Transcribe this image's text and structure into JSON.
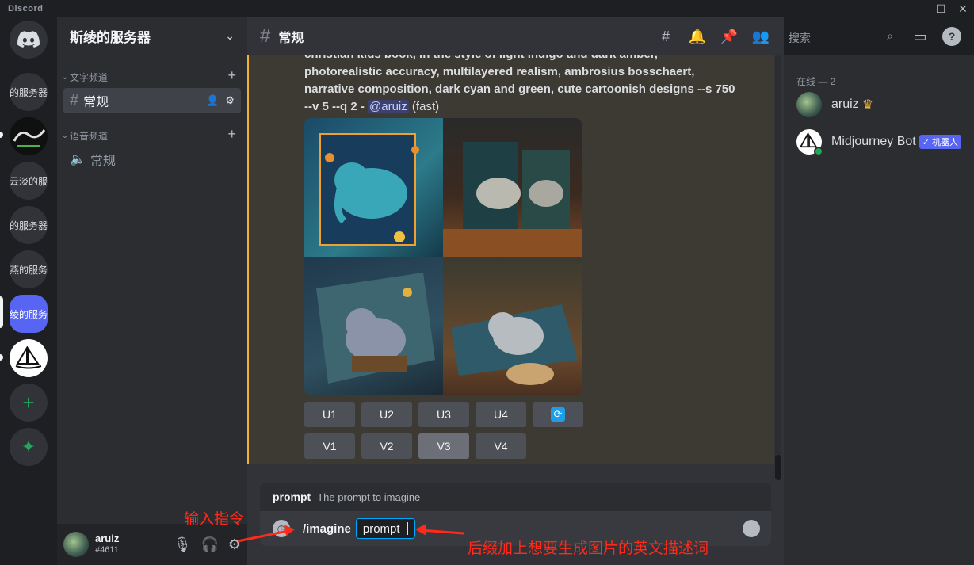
{
  "app": {
    "brand": "Discord"
  },
  "window_controls": {
    "minimize": "—",
    "maximize": "☐",
    "close": "✕"
  },
  "servers": [
    {
      "name": "的服务器"
    },
    {
      "name": ""
    },
    {
      "name": "云淡的服务"
    },
    {
      "name": "的服务器"
    },
    {
      "name": "燕的服务"
    },
    {
      "name": "绫的服务"
    }
  ],
  "guild": {
    "name": "斯绫的服务器"
  },
  "categories": {
    "text": "文字频道",
    "voice": "语音频道"
  },
  "channels": {
    "text_general": "常规",
    "voice_general": "常规"
  },
  "user": {
    "name": "aruiz",
    "tag": "#4611"
  },
  "chat": {
    "channel_name": "常规",
    "message_line1": "christian kids book, in the style of light indigo and dark amber,",
    "message_line2": "photorealistic accuracy, multilayered realism, ambrosius bosschaert,",
    "message_line3": "narrative composition, dark cyan and green, cute cartoonish designs --s 750",
    "message_line4": "--v 5 --q 2 - ",
    "mention": "@aruiz",
    "suffix": " (fast)",
    "buttons_u": [
      "U1",
      "U2",
      "U3",
      "U4"
    ],
    "buttons_v": [
      "V1",
      "V2",
      "V3",
      "V4"
    ],
    "reroll_icon": "refresh-icon"
  },
  "command": {
    "option_name": "prompt",
    "option_desc": "The prompt to imagine",
    "name": "/imagine",
    "value": "prompt"
  },
  "search": {
    "placeholder": "搜索"
  },
  "members": {
    "heading": "在线 — 2",
    "list": [
      {
        "name": "aruiz",
        "crown": "♛"
      },
      {
        "name": "Midjourney Bot",
        "badge": "✓ 机器人"
      }
    ]
  },
  "annotations": {
    "input_cmd": "输入指令",
    "suffix_hint": "后缀加上想要生成图片的英文描述词"
  },
  "colors": {
    "accent": "#5865f2",
    "highlight_border": "#f0b232",
    "annotation": "#ff2a1a",
    "online": "#23a55a"
  }
}
